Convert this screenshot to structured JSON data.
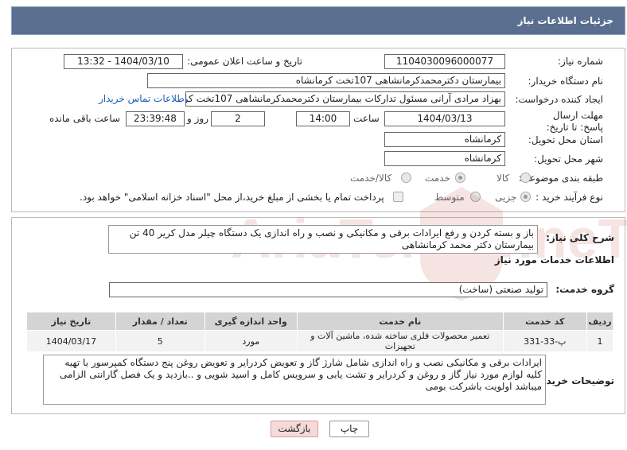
{
  "header": {
    "title": "جزئیات اطلاعات نیاز"
  },
  "fields": {
    "need_number": {
      "label": "شماره نیاز:",
      "value": "1104030096000077"
    },
    "announce_datetime": {
      "label": "تاریخ و ساعت اعلان عمومی:",
      "value": "1404/03/10 - 13:32"
    },
    "buyer_org": {
      "label": "نام دستگاه خریدار:",
      "value": "بیمارستان دکترمحمدکرمانشاهی 107تخت کرمانشاه"
    },
    "requester": {
      "label": "ایجاد کننده درخواست:",
      "value": "بهزاد مرادی آرانی مسئول تدارکات بیمارستان دکترمحمدکرمانشاهی 107تخت کر"
    },
    "buyer_contact_link": "اطلاعات تماس خریدار",
    "deadline": {
      "label": "مهلت ارسال پاسخ: تا تاریخ:",
      "date": "1404/03/13",
      "time_label": "ساعت",
      "time": "14:00",
      "days": "2",
      "days_label": "روز و",
      "remaining": "23:39:48",
      "remaining_label": "ساعت باقی مانده"
    },
    "delivery_province": {
      "label": "استان محل تحویل:",
      "value": "کرمانشاه"
    },
    "delivery_city": {
      "label": "شهر محل تحویل:",
      "value": "کرمانشاه"
    },
    "category": {
      "label": "طبقه بندی موضوعی:",
      "options": [
        "کالا",
        "خدمت",
        "کالا/خدمت"
      ],
      "selected": "خدمت"
    },
    "purchase_type": {
      "label": "نوع فرآیند خرید :",
      "options": [
        "جزیی",
        "متوسط"
      ],
      "selected": "جزیی",
      "note": "پرداخت تمام یا بخشی از مبلغ خرید،از محل \"اسناد خزانه اسلامی\" خواهد بود."
    }
  },
  "summary": {
    "label": "شرح کلی نیاز:",
    "text": "باز و بسته کردن و رفع ایرادات برقی و مکانیکی و نصب و راه اندازی یک دستگاه چیلر مدل کریر 40 تن بیمارستان دکتر محمد کرمانشاهی"
  },
  "services_section": {
    "title": "اطلاعات خدمات مورد نیاز",
    "group_label": "گروه خدمت:",
    "group_value": "تولید صنعتی (ساخت)",
    "columns": [
      "ردیف",
      "کد خدمت",
      "نام خدمت",
      "واحد اندازه گیری",
      "تعداد / مقدار",
      "تاریخ نیاز"
    ],
    "rows": [
      [
        "1",
        "پ-33-331",
        "تعمیر محصولات فلزی ساخته شده، ماشین آلات و تجهیزات",
        "مورد",
        "5",
        "1404/03/17"
      ]
    ]
  },
  "buyer_notes": {
    "label": "توضیحات خریدار:",
    "text": "ایرادات برقی و مکانیکی نصب و راه اندازی شامل شارژ گاز و تعویض کردرایر و تعویض روغن پنج دستگاه کمپرسور با تهیه کلیه لوازم مورد نیاز گاز و روغن و کردرایر و تشت یابی و سرویس کامل و اسید شویی و ..بازدید و یک فصل گارانتی الزامی میباشد اولویت باشرکت بومی"
  },
  "buttons": {
    "back": "بازگشت",
    "print": "چاپ"
  },
  "watermark": "AriaTender.neT",
  "colors": {
    "header": "#5a6f8f",
    "link": "#1a5fb4",
    "back_button": "#f5dada"
  }
}
